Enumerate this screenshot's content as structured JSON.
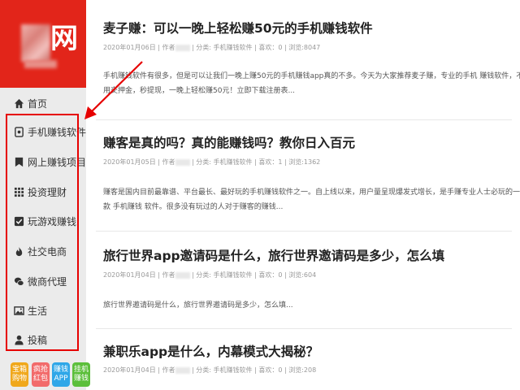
{
  "logo": {
    "char": "网",
    "colors": {
      "bg": "#e2251a"
    }
  },
  "nav": [
    {
      "label": "首页",
      "icon": "home-icon"
    },
    {
      "label": "手机赚钱软件",
      "icon": "phone-icon"
    },
    {
      "label": "网上赚钱项目",
      "icon": "bookmark-icon"
    },
    {
      "label": "投资理财",
      "icon": "grid-icon"
    },
    {
      "label": "玩游戏赚钱",
      "icon": "check-square-icon"
    },
    {
      "label": "社交电商",
      "icon": "fire-icon"
    },
    {
      "label": "微商代理",
      "icon": "wechat-icon"
    },
    {
      "label": "生活",
      "icon": "image-icon"
    },
    {
      "label": "投稿",
      "icon": "user-icon"
    }
  ],
  "badges": [
    {
      "l1": "宝箱",
      "l2": "购物",
      "color": "#f0a81c"
    },
    {
      "l1": "疯抢",
      "l2": "红包",
      "color": "#f26b6b"
    },
    {
      "l1": "赚钱",
      "l2": "APP",
      "color": "#2fa7e8"
    },
    {
      "l1": "挂机",
      "l2": "赚钱",
      "color": "#5cbf3b"
    }
  ],
  "articles": [
    {
      "title": "麦子赚：可以一晚上轻松赚50元的手机赚钱软件",
      "date": "2020年01月06日",
      "author_prefix": "| 作者",
      "category": "| 分类: 手机赚钱软件",
      "likes": "| 喜欢：0",
      "views": "| 浏览:8047",
      "excerpt_l1": "手机赚钱软件有很多，但是可以让我们一晚上赚50元的手机赚钱app真的不多。今天为大家推荐麦子赚，专业的手机 赚钱软件，不",
      "excerpt_l2": "用交押金，秒提现，一晚上轻松赚50元！立即下载注册表..."
    },
    {
      "title": "赚客是真的吗？真的能赚钱吗？教你日入百元",
      "date": "2020年01月05日",
      "author_prefix": "| 作者",
      "category": "| 分类: 手机赚钱软件",
      "likes": "| 喜欢：1",
      "views": "| 浏览:1362",
      "excerpt_l1": "赚客是国内目前最靠谱、平台最长、最好玩的手机赚钱软件之一。自上线以来，用户量呈现爆发式增长，是手赚专业人士必玩的一",
      "excerpt_l2": "款 手机赚钱 软件。很多没有玩过的人对于赚客的赚钱..."
    },
    {
      "title": "旅行世界app邀请码是什么，旅行世界邀请码是多少，怎么填",
      "date": "2020年01月04日",
      "author_prefix": "| 作者",
      "category": "| 分类: 手机赚钱软件",
      "likes": "| 喜欢：0",
      "views": "| 浏览:604",
      "excerpt_l1": "旅行世界邀请码是什么，旅行世界邀请码是多少，怎么填...",
      "excerpt_l2": ""
    },
    {
      "title": "兼职乐app是什么，内幕模式大揭秘？",
      "date": "2020年01月04日",
      "author_prefix": "| 作者",
      "category": "| 分类: 手机赚钱软件",
      "likes": "| 喜欢：0",
      "views": "| 浏览:208",
      "excerpt_l1": "",
      "excerpt_l2": ""
    }
  ],
  "annotation": {
    "color": "#e60000"
  }
}
